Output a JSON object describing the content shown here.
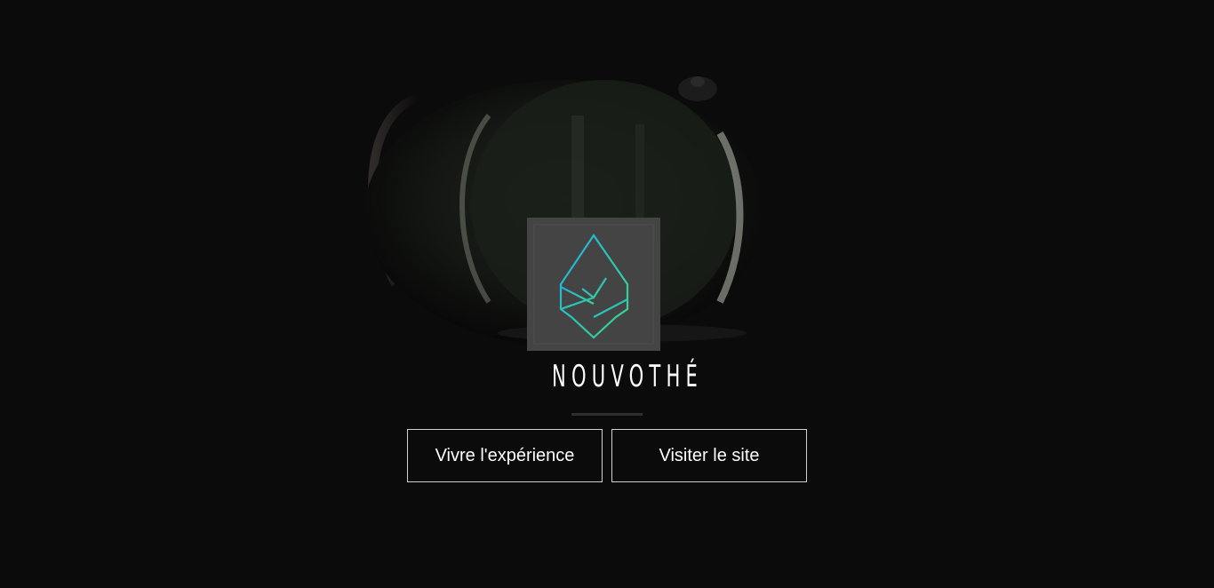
{
  "brand": {
    "name": "NOUVOTHÉ",
    "logo_colors": [
      "#1fb0e0",
      "#2fc7b0",
      "#3bd68a"
    ]
  },
  "background": {
    "color": "#0b0b0b",
    "image": "glass-teapot"
  },
  "actions": {
    "experience_label": "Vivre l'expérience",
    "site_label": "Visiter le site"
  }
}
